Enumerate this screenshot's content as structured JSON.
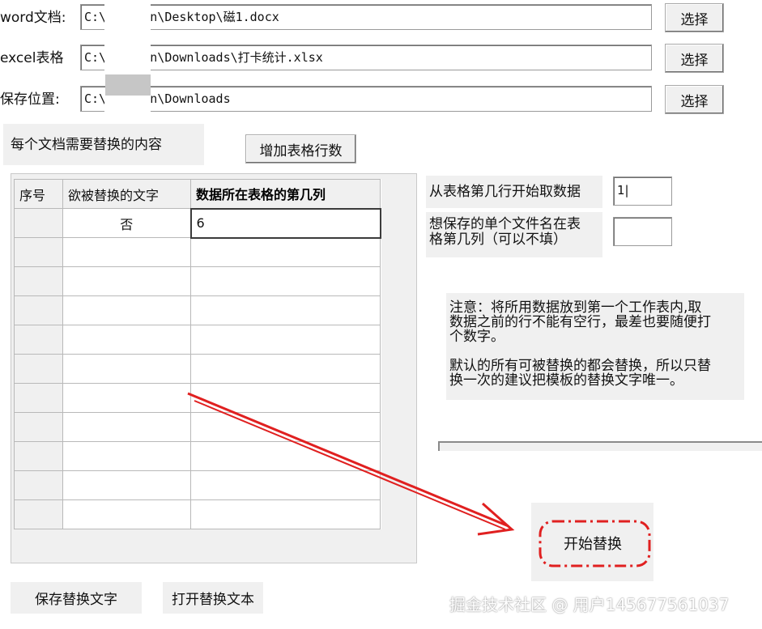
{
  "paths": {
    "word_label": "word文档:",
    "word_value": "C:\\          hettin\\Desktop\\磁1.docx",
    "excel_label": "excel表格",
    "excel_value": "C:\\          hettin\\Downloads\\打卡统计.xlsx",
    "save_label": "保存位置:",
    "save_value": "C:\\          hettin\\Downloads",
    "choose_label": "选择"
  },
  "replace_section": {
    "title": "每个文档需要替换的内容",
    "add_rows_button": "增加表格行数"
  },
  "table": {
    "headers": [
      "序号",
      "欲被替换的文字",
      "数据所在表格的第几列"
    ],
    "rows": [
      [
        "",
        "否",
        "6"
      ],
      [
        "",
        "",
        ""
      ],
      [
        "",
        "",
        ""
      ],
      [
        "",
        "",
        ""
      ],
      [
        "",
        "",
        ""
      ],
      [
        "",
        "",
        ""
      ],
      [
        "",
        "",
        ""
      ],
      [
        "",
        "",
        ""
      ],
      [
        "",
        "",
        ""
      ],
      [
        "",
        "",
        ""
      ],
      [
        "",
        "",
        ""
      ]
    ]
  },
  "options": {
    "start_row_label": "从表格第几行开始取数据",
    "start_row_value": "1|",
    "filename_col_label_line1": "想保存的单个文件名在表",
    "filename_col_label_line2": "格第几列（可以不填）",
    "filename_col_value": ""
  },
  "notes": {
    "line1": "注意：将所用数据放到第一个工作表内,取",
    "line2": "数据之前的行不能有空行，最差也要随便打",
    "line3": "个数字。",
    "line4": "默认的所有可被替换的都会替换，所以只替",
    "line5": "换一次的建议把模板的替换文字唯一。"
  },
  "actions": {
    "start_button": "开始替换",
    "save_text_button": "保存替换文字",
    "open_text_button": "打开替换文本"
  },
  "watermark": "掘金技术社区 @ 用户145677561037",
  "colors": {
    "annotation_red": "#e02020",
    "window_bg": "#f0f0f0"
  }
}
